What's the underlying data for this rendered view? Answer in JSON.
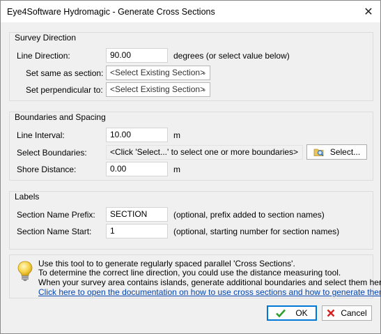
{
  "window": {
    "title": "Eye4Software Hydromagic - Generate Cross Sections"
  },
  "survey": {
    "title": "Survey Direction",
    "line_direction_label": "Line Direction:",
    "line_direction_value": "90.00",
    "line_direction_hint": "degrees (or select value below)",
    "same_as_label": "Set same as section:",
    "same_as_value": "<Select Existing Section>",
    "perpendicular_label": "Set perpendicular to:",
    "perpendicular_value": "<Select Existing Section>"
  },
  "boundaries": {
    "title": "Boundaries and Spacing",
    "interval_label": "Line Interval:",
    "interval_value": "10.00",
    "interval_unit": "m",
    "select_label": "Select Boundaries:",
    "select_value": "<Click 'Select...' to select one or more boundaries>",
    "select_button": "Select...",
    "shore_label": "Shore Distance:",
    "shore_value": "0.00",
    "shore_unit": "m"
  },
  "labels": {
    "title": "Labels",
    "prefix_label": "Section Name Prefix:",
    "prefix_value": "SECTION",
    "prefix_hint": "(optional, prefix added to section names)",
    "start_label": "Section Name Start:",
    "start_value": "1",
    "start_hint": "(optional, starting number for section names)"
  },
  "info": {
    "line1": "Use this tool to to generate regularly spaced parallel 'Cross Sections'.",
    "line2": "To determine the correct line direction, you could use the distance measuring tool.",
    "line3": "When your survey area contains islands, generate additional boundaries and select them here.",
    "link": "Click here to open the documentation on how to use cross sections and how to generate them."
  },
  "buttons": {
    "ok": "OK",
    "cancel": "Cancel"
  },
  "colors": {
    "ok_check": "#2e9e2e",
    "cancel_x": "#d42020",
    "link": "#0645ad"
  }
}
